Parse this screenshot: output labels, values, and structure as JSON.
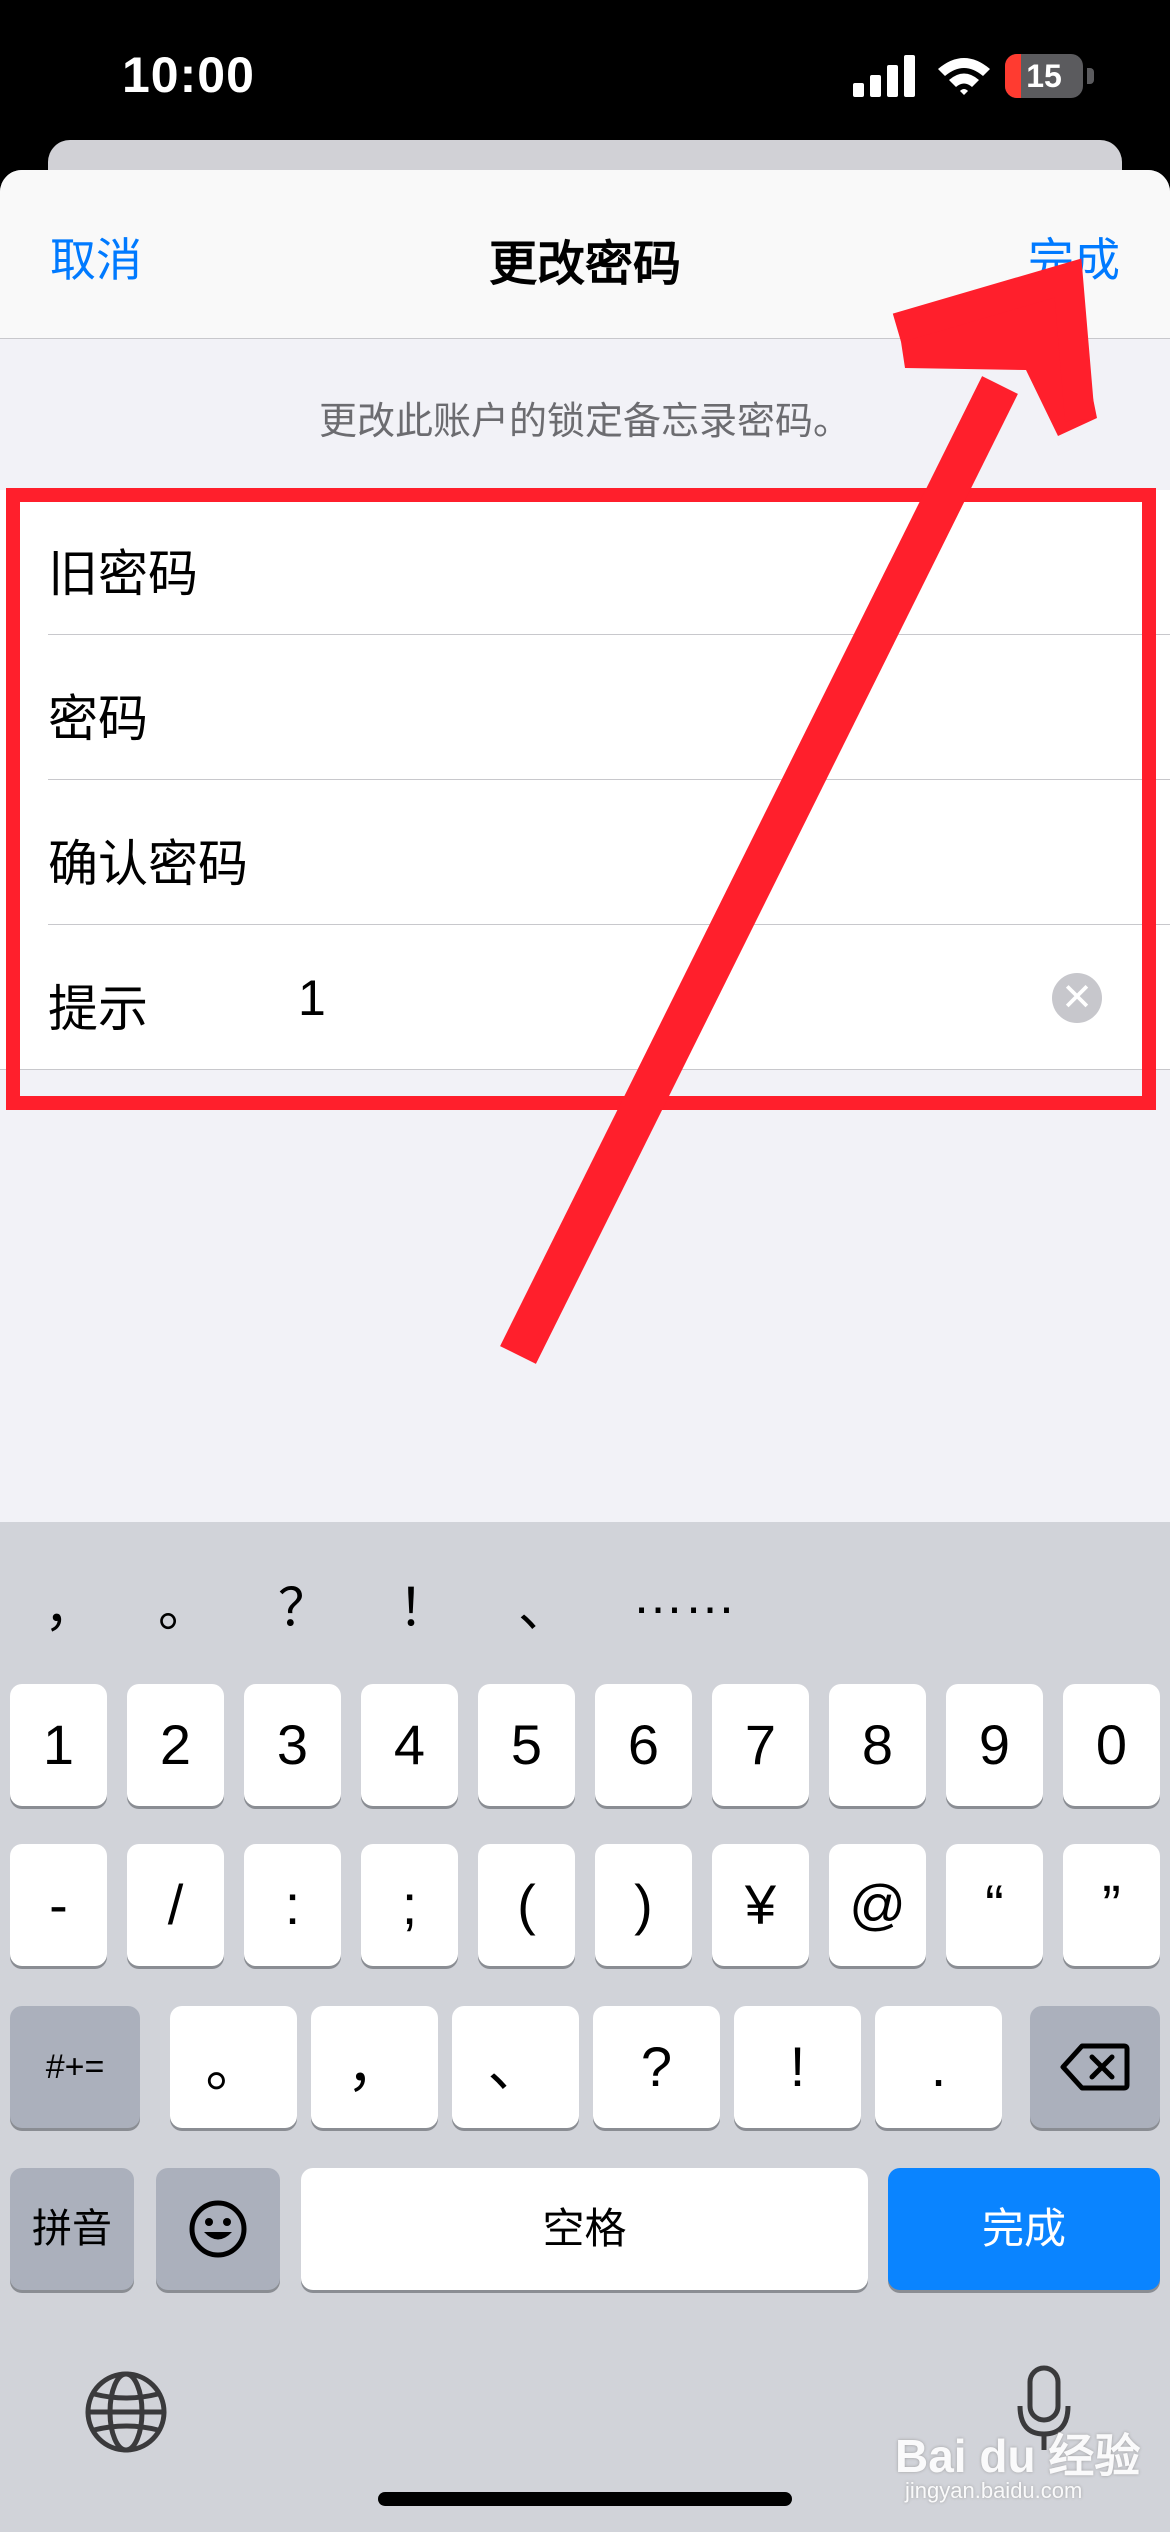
{
  "status": {
    "time": "10:00",
    "battery": "15"
  },
  "nav": {
    "cancel": "取消",
    "title": "更改密码",
    "done": "完成"
  },
  "description": "更改此账户的锁定备忘录密码。",
  "form": {
    "old_password_label": "旧密码",
    "password_label": "密码",
    "confirm_label": "确认密码",
    "hint_label": "提示",
    "hint_value": "1"
  },
  "keyboard": {
    "candidates": [
      "，",
      "。",
      "？",
      "！",
      "、",
      "……"
    ],
    "row1": [
      "1",
      "2",
      "3",
      "4",
      "5",
      "6",
      "7",
      "8",
      "9",
      "0"
    ],
    "row2": [
      "-",
      "/",
      ":",
      ";",
      "(",
      ")",
      "¥",
      "@",
      "“",
      "”"
    ],
    "symbols_key": "#+=",
    "row3": [
      "。",
      "，",
      "、",
      "?",
      "!",
      "."
    ],
    "pinyin_key": "拼音",
    "space_key": "空格",
    "done_key": "完成"
  },
  "watermark": {
    "brand": "Bai du 经验",
    "url": "jingyan.baidu.com"
  },
  "colors": {
    "accent": "#007aff",
    "annotation": "#ff1f2c"
  }
}
